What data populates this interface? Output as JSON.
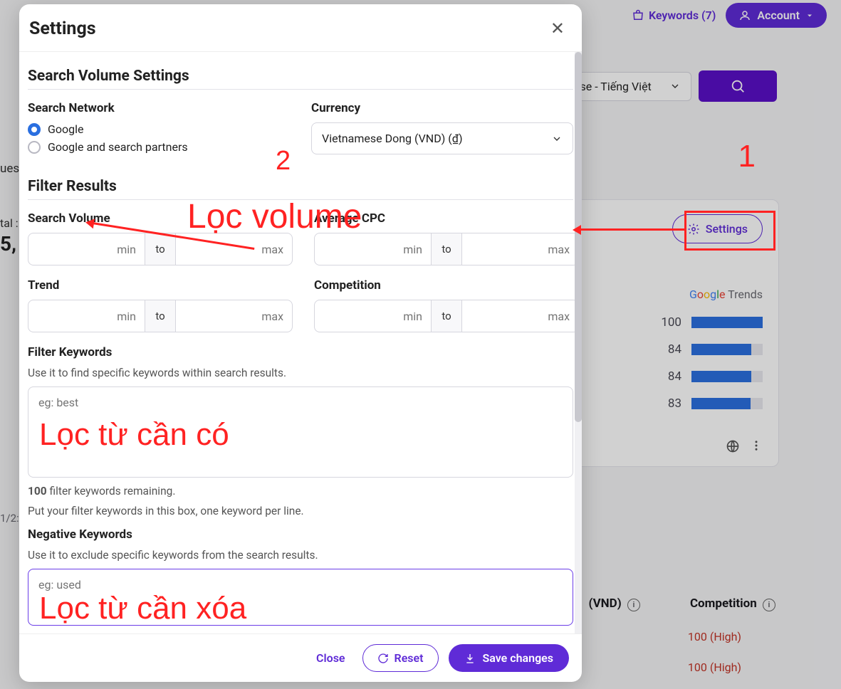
{
  "topbar": {
    "keywords_label": "Keywords (7)",
    "account_label": "Account"
  },
  "lang_select": "ese - Tiếng Việt",
  "bg_fragments": {
    "ues": "ues",
    "tal": "tal :",
    "five": "5,",
    "date": "1/2:"
  },
  "trends": {
    "settings_label": "Settings",
    "brand": "Trends",
    "rows": [
      {
        "value": "100",
        "pct": 100
      },
      {
        "value": "84",
        "pct": 84
      },
      {
        "value": "84",
        "pct": 84
      },
      {
        "value": "83",
        "pct": 83
      }
    ]
  },
  "cols": {
    "vnd": "(VND)",
    "competition": "Competition"
  },
  "comp_values": [
    "100 (High)",
    "100 (High)"
  ],
  "modal": {
    "title": "Settings",
    "sec1": "Search Volume Settings",
    "network_label": "Search Network",
    "network_opt1": "Google",
    "network_opt2": "Google and search partners",
    "currency_label": "Currency",
    "currency_value": "Vietnamese Dong (VND) (₫)",
    "sec2": "Filter Results",
    "search_volume_label": "Search Volume",
    "avg_cpc_label": "Average CPC",
    "trend_label": "Trend",
    "competition_label": "Competition",
    "min_ph": "min",
    "max_ph": "max",
    "to_label": "to",
    "filter_kw_label": "Filter Keywords",
    "filter_kw_help": "Use it to find specific keywords within search results.",
    "filter_kw_ph": "eg: best",
    "remaining_bold": "100",
    "remaining_text": " filter keywords remaining.",
    "perline": "Put your filter keywords in this box, one keyword per line.",
    "neg_kw_label": "Negative Keywords",
    "neg_kw_help": "Use it to exclude specific keywords from the search results.",
    "neg_kw_ph": "eg: used",
    "close": "Close",
    "reset": "Reset",
    "save": "Save changes"
  },
  "annotations": {
    "num1": "1",
    "num2": "2",
    "loc_volume": "Lọc volume",
    "loc_tu": "Lọc từ cần có",
    "loc_xoa": "Lọc từ cần xóa"
  }
}
